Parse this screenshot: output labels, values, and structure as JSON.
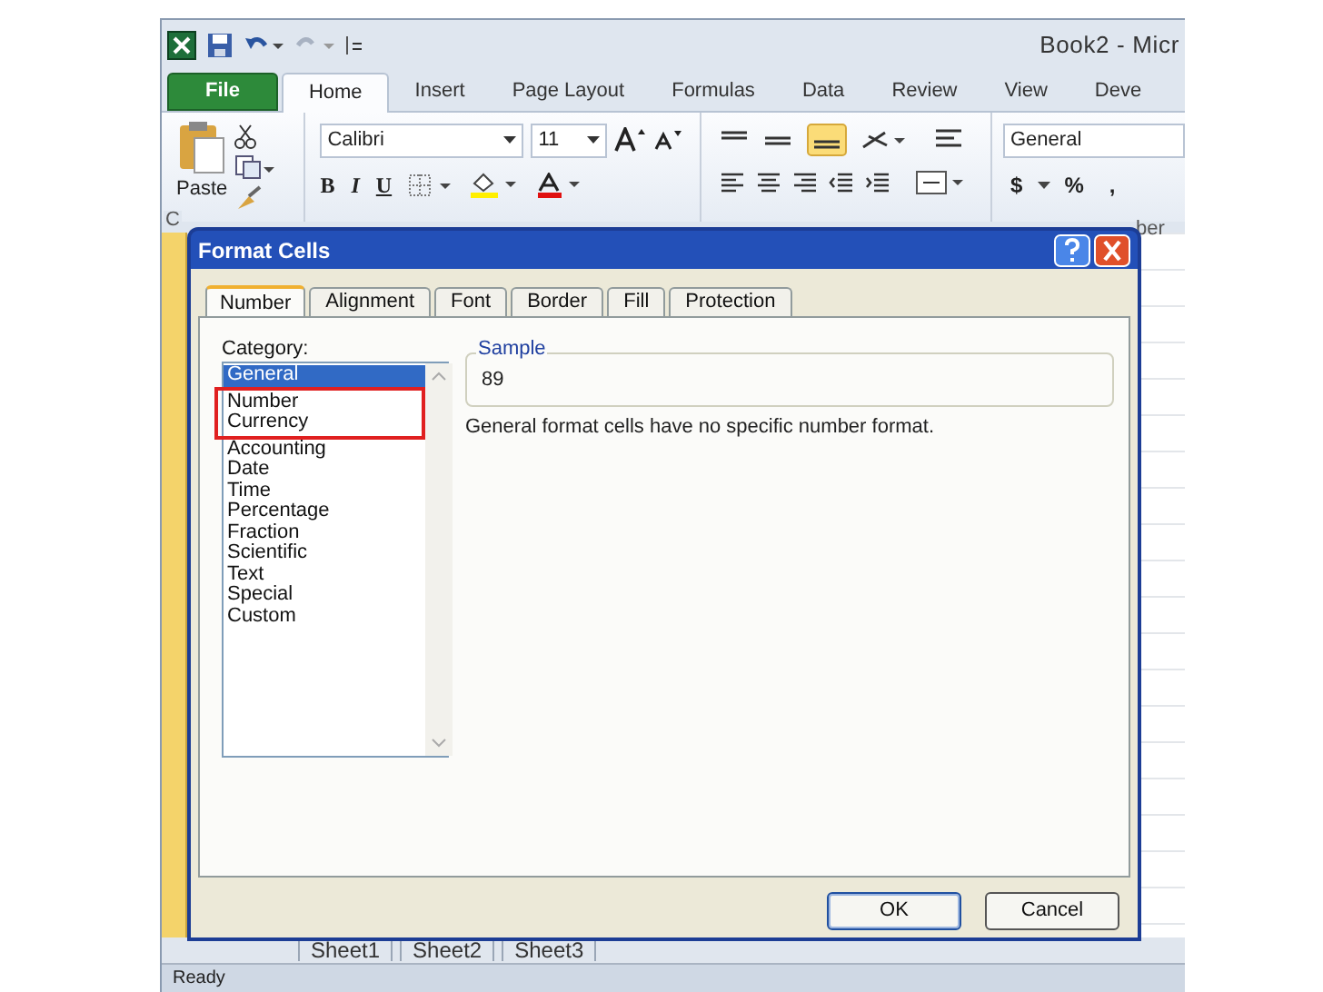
{
  "window": {
    "title": "Book2 - Micr"
  },
  "ribbon_tabs": [
    {
      "label": "File",
      "kind": "file",
      "selected": false
    },
    {
      "label": "Home",
      "kind": "tab",
      "selected": true
    },
    {
      "label": "Insert",
      "kind": "tab",
      "selected": false
    },
    {
      "label": "Page Layout",
      "kind": "tab",
      "selected": false
    },
    {
      "label": "Formulas",
      "kind": "tab",
      "selected": false
    },
    {
      "label": "Data",
      "kind": "tab",
      "selected": false
    },
    {
      "label": "Review",
      "kind": "tab",
      "selected": false
    },
    {
      "label": "View",
      "kind": "tab",
      "selected": false
    },
    {
      "label": "Deve",
      "kind": "tab",
      "selected": false
    }
  ],
  "ribbon": {
    "paste": "Paste",
    "font": "Calibri",
    "size": "11",
    "bold": "B",
    "italic": "I",
    "underline": "U",
    "number_format": "General",
    "currency": "$",
    "percent": "%",
    "comma": ",",
    "group_label_left": "C",
    "group_label_right": "ber"
  },
  "dialog": {
    "title": "Format Cells",
    "tabs": [
      {
        "label": "Number",
        "selected": true
      },
      {
        "label": "Alignment",
        "selected": false
      },
      {
        "label": "Font",
        "selected": false
      },
      {
        "label": "Border",
        "selected": false
      },
      {
        "label": "Fill",
        "selected": false
      },
      {
        "label": "Protection",
        "selected": false
      }
    ],
    "category_label": "Category:",
    "categories": [
      {
        "label": "General",
        "selected": true,
        "highlighted": false
      },
      {
        "label": "Number",
        "selected": false,
        "highlighted": true
      },
      {
        "label": "Currency",
        "selected": false,
        "highlighted": true
      },
      {
        "label": "Accounting",
        "selected": false,
        "highlighted": false
      },
      {
        "label": "Date",
        "selected": false,
        "highlighted": false
      },
      {
        "label": "Time",
        "selected": false,
        "highlighted": false
      },
      {
        "label": "Percentage",
        "selected": false,
        "highlighted": false
      },
      {
        "label": "Fraction",
        "selected": false,
        "highlighted": false
      },
      {
        "label": "Scientific",
        "selected": false,
        "highlighted": false
      },
      {
        "label": "Text",
        "selected": false,
        "highlighted": false
      },
      {
        "label": "Special",
        "selected": false,
        "highlighted": false
      },
      {
        "label": "Custom",
        "selected": false,
        "highlighted": false
      }
    ],
    "sample_label": "Sample",
    "sample_value": "89",
    "description": "General format cells have no specific number format.",
    "buttons": [
      "OK",
      "Cancel"
    ]
  },
  "sheet_tabs": [
    "Sheet1",
    "Sheet2",
    "Sheet3"
  ],
  "status_bar": "Ready"
}
